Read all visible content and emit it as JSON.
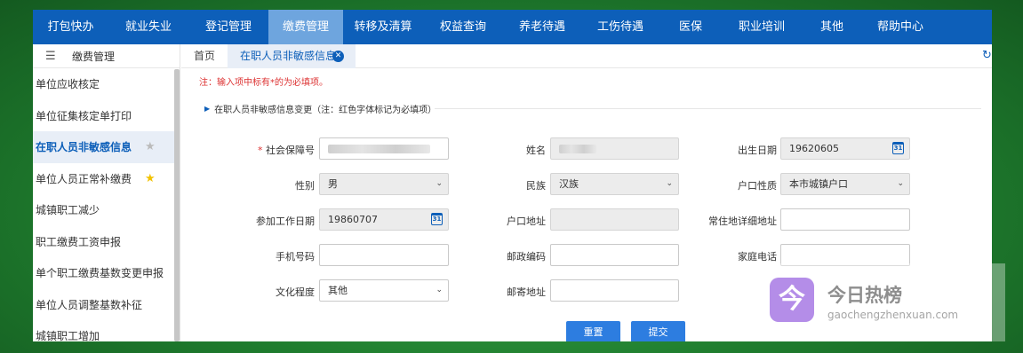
{
  "topnav": [
    {
      "label": "打包快办",
      "active": false
    },
    {
      "label": "就业失业",
      "active": false
    },
    {
      "label": "登记管理",
      "active": false
    },
    {
      "label": "缴费管理",
      "active": true
    },
    {
      "label": "转移及清算",
      "active": false
    },
    {
      "label": "权益查询",
      "active": false
    },
    {
      "label": "养老待遇",
      "active": false
    },
    {
      "label": "工伤待遇",
      "active": false
    },
    {
      "label": "医保",
      "active": false
    },
    {
      "label": "职业培训",
      "active": false
    },
    {
      "label": "其他",
      "active": false
    },
    {
      "label": "帮助中心",
      "active": false
    }
  ],
  "sidebar": {
    "title": "缴费管理",
    "items": [
      {
        "label": "单位应收核定"
      },
      {
        "label": "单位征集核定单打印"
      },
      {
        "label": "在职人员非敏感信息",
        "active": true,
        "star": "grey"
      },
      {
        "label": "单位人员正常补缴费",
        "star": "gold"
      },
      {
        "label": "城镇职工减少"
      },
      {
        "label": "职工缴费工资申报"
      },
      {
        "label": "单个职工缴费基数变更申报"
      },
      {
        "label": "单位人员调整基数补征"
      },
      {
        "label": "城镇职工增加"
      }
    ]
  },
  "tabs": {
    "home": "首页",
    "current": "在职人员非敏感信息"
  },
  "form": {
    "note": "注：输入项中标有*的为必填项。",
    "section_title": "在职人员非敏感信息变更（注：红色字体标记为必填项）",
    "labels": {
      "ssn": "社会保障号",
      "name": "姓名",
      "birth": "出生日期",
      "gender": "性别",
      "ethnicity": "民族",
      "hukou_type": "户口性质",
      "work_start": "参加工作日期",
      "hukou_address": "户口地址",
      "residence": "常住地详细地址",
      "mobile": "手机号码",
      "postcode": "邮政编码",
      "home_phone": "家庭电话",
      "education": "文化程度",
      "mail_address": "邮寄地址"
    },
    "values": {
      "birth": "19620605",
      "gender": "男",
      "ethnicity": "汉族",
      "hukou_type": "本市城镇户口",
      "work_start": "19860707",
      "education": "其他"
    },
    "buttons": {
      "reset": "重置",
      "submit": "提交"
    }
  },
  "watermark": {
    "logo_char": "今",
    "title": "今日热榜",
    "subtitle": "gaochengzhenxuan.com"
  },
  "colors": {
    "nav_bg": "#0d5fb9",
    "nav_active": "#6ea5de",
    "button": "#2d7de0",
    "required": "#dd3333"
  }
}
